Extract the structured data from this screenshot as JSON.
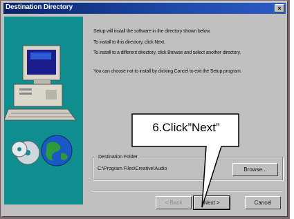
{
  "window": {
    "title": "Destination Directory",
    "close_label": "×"
  },
  "body": {
    "line1": "Setup will install the software in the directory shown below.",
    "line2": "To install to this directory, click Next.",
    "line3": "To install to a different directory, click Browse and select another directory.",
    "line4": "You can choose not to install by clicking Cancel to exit the Setup program."
  },
  "destination": {
    "label": "Destination Folder",
    "path": "C:\\Program Files\\Creative\\Audio"
  },
  "buttons": {
    "browse": "Browse...",
    "back": "< Back",
    "next": "Next >",
    "cancel": "Cancel"
  },
  "callout": {
    "text": "6.Click”Next”"
  }
}
